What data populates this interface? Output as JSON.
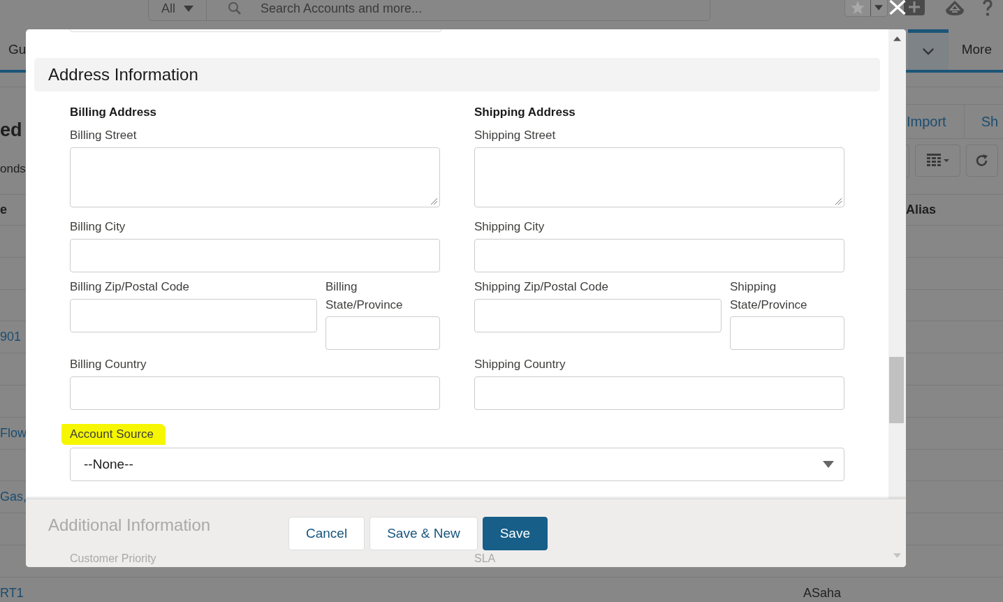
{
  "background": {
    "global_search": {
      "scope": "All",
      "placeholder": "Search Accounts and more..."
    },
    "nav_tabs": [
      {
        "label": "Gu",
        "selected": false
      },
      {
        "selected": true
      },
      {
        "label": "More",
        "selected": false
      }
    ],
    "page_title": "ed",
    "page_subtitle": "onds",
    "list_actions": [
      "Import",
      "Sh"
    ],
    "columns": [
      "e",
      "Alias"
    ],
    "rows": [
      {},
      {},
      {},
      {
        "name": "901"
      },
      {},
      {},
      {
        "name": "Flow"
      },
      {},
      {
        "name": "Gas,"
      },
      {},
      {},
      {
        "name": "RT1",
        "alias": "ASaha"
      }
    ]
  },
  "modal": {
    "section_title": "Address Information",
    "address_columns": [
      {
        "heading": "Billing Address",
        "fields": [
          {
            "kind": "textarea",
            "label": "Billing Street"
          },
          {
            "kind": "input",
            "label": "Billing City"
          },
          {
            "kind": "split",
            "fields": [
              {
                "label": "Billing Zip/Postal Code"
              },
              {
                "label": "Billing State/Province"
              }
            ]
          },
          {
            "kind": "input",
            "label": "Billing Country"
          }
        ]
      },
      {
        "heading": "Shipping Address",
        "fields": [
          {
            "kind": "textarea",
            "label": "Shipping Street"
          },
          {
            "kind": "input",
            "label": "Shipping City"
          },
          {
            "kind": "split",
            "fields": [
              {
                "label": "Shipping Zip/Postal Code"
              },
              {
                "label": "Shipping State/Province"
              }
            ]
          },
          {
            "kind": "input",
            "label": "Shipping Country"
          }
        ]
      }
    ],
    "account_source": {
      "label": "Account Source",
      "value": "--None--",
      "highlighted": true
    },
    "next_section": {
      "title": "Additional Information",
      "fields": [
        "Customer Priority",
        "SLA"
      ]
    },
    "buttons": [
      {
        "label": "Cancel",
        "kind": "neutral"
      },
      {
        "label": "Save & New",
        "kind": "neutral"
      },
      {
        "label": "Save",
        "kind": "brand"
      }
    ]
  }
}
